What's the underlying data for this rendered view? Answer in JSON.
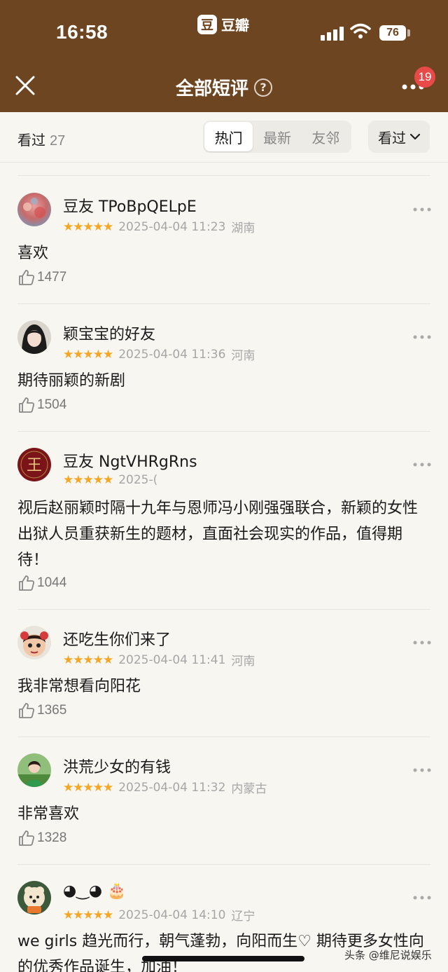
{
  "status_bar": {
    "time": "16:58",
    "app_label": "豆瓣",
    "app_logo_char": "豆",
    "battery": "76"
  },
  "header": {
    "title": "全部短评",
    "help_icon": "question-circle-icon",
    "badge": "19"
  },
  "filters": {
    "seen_label": "看过",
    "seen_count": "27",
    "tabs": [
      {
        "label": "热门",
        "active": true
      },
      {
        "label": "最新",
        "active": false
      },
      {
        "label": "友邻",
        "active": false
      }
    ],
    "dropdown": "看过"
  },
  "comments": [
    {
      "user": "豆友 TPoBpQELpE",
      "stars": "★★★★★",
      "time": "2025-04-04 11:23",
      "location": "湖南",
      "text": "喜欢",
      "likes": "1477"
    },
    {
      "user": "颖宝宝的好友",
      "stars": "★★★★★",
      "time": "2025-04-04 11:36",
      "location": "河南",
      "text": "期待丽颖的新剧",
      "likes": "1504"
    },
    {
      "user": "豆友 NgtVHRgRns",
      "stars": "★★★★★",
      "time": "2025-(",
      "location": "",
      "text": "视后赵丽颖时隔十九年与恩师冯小刚强强联合，新颖的女性出狱人员重获新生的题材，直面社会现实的作品，值得期待！",
      "likes": "1044"
    },
    {
      "user": "还吃生你们来了",
      "stars": "★★★★★",
      "time": "2025-04-04 11:41",
      "location": "河南",
      "text": "我非常想看向阳花",
      "likes": "1365"
    },
    {
      "user": "洪荒少女的有钱",
      "stars": "★★★★★",
      "time": "2025-04-04 11:32",
      "location": "内蒙古",
      "text": "非常喜欢",
      "likes": "1328"
    },
    {
      "user": "◕‿◕ 🎂",
      "stars": "★★★★★",
      "time": "2025-04-04 14:10",
      "location": "辽宁",
      "text": "we girls 趋光而行，朝气蓬勃，向阳而生♡ 期待更多女性向的优秀作品诞生，加油！",
      "likes": ""
    }
  ],
  "watermark": "头条 @维尼说娱乐"
}
